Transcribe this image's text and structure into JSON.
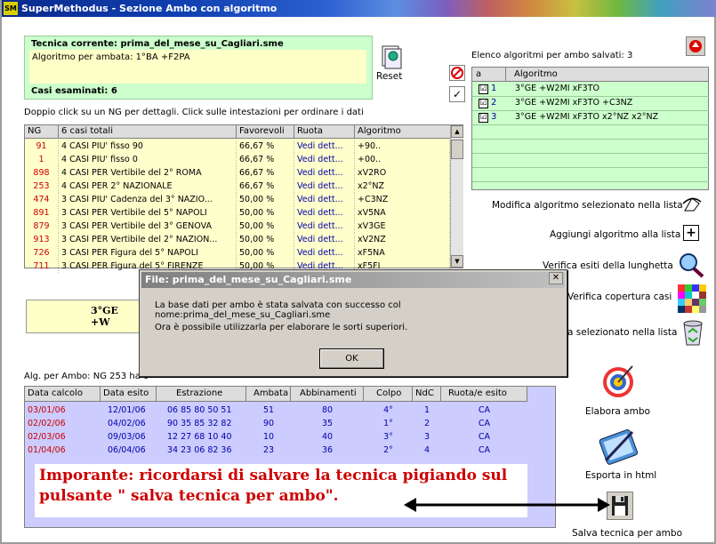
{
  "window": {
    "title": "SuperMethodus - Sezione Ambo con algoritmo",
    "icon_text": "SM"
  },
  "tecnica": {
    "title": "Tecnica corrente: prima_del_mese_su_Cagliari.sme",
    "algoritmo": "Algoritmo per ambata: 1°BA +F2PA",
    "casi": "Casi esaminati: 6"
  },
  "reset_label": "Reset",
  "hint_text": "Doppio click su un NG per dettagli. Click sulle intestazioni per ordinare i dati",
  "ng_table": {
    "headers": [
      "NG",
      "6 casi totali",
      "Favorevoli",
      "Ruota",
      "Algoritmo"
    ],
    "rows": [
      [
        "91",
        "4 CASI PIU' fisso 90",
        "66,67 %",
        "Vedi dett...",
        "+90.."
      ],
      [
        "1",
        "4 CASI PIU' fisso 0",
        "66,67 %",
        "Vedi dett...",
        "+00.."
      ],
      [
        "898",
        "4 CASI PER Vertibile del 2° ROMA",
        "66,67 %",
        "Vedi dett...",
        "xV2RO"
      ],
      [
        "253",
        "4 CASI PER 2° NAZIONALE",
        "66,67 %",
        "Vedi dett...",
        "x2°NZ"
      ],
      [
        "474",
        "3 CASI PIU' Cadenza del 3° NAZIO...",
        "50,00 %",
        "Vedi dett...",
        "+C3NZ"
      ],
      [
        "891",
        "3 CASI PER Vertibile del 5° NAPOLI",
        "50,00 %",
        "Vedi dett...",
        "xV5NA"
      ],
      [
        "879",
        "3 CASI PER Vertibile del 3° GENOVA",
        "50,00 %",
        "Vedi dett...",
        "xV3GE"
      ],
      [
        "913",
        "3 CASI PER Vertibile del 2° NAZION...",
        "50,00 %",
        "Vedi dett...",
        "xV2NZ"
      ],
      [
        "726",
        "3 CASI PER Figura del 5° NAPOLI",
        "50,00 %",
        "Vedi dett...",
        "xF5NA"
      ],
      [
        "711",
        "3 CASI PER Figura del 5° FIRENZE",
        "50,00 %",
        "Vedi dett...",
        "xF5FI"
      ]
    ]
  },
  "yellow_text": "3°GE +W",
  "elenco_label": "Elenco algoritmi per ambo salvati: 3",
  "algo_list": {
    "headers": [
      "a",
      "Algoritmo"
    ],
    "rows": [
      {
        "checked": "☑",
        "n": "1",
        "alg": "3°GE +W2MI xF3TO"
      },
      {
        "checked": "☑",
        "n": "2",
        "alg": "3°GE +W2MI xF3TO +C3NZ"
      },
      {
        "checked": "☑",
        "n": "3",
        "alg": "3°GE +W2MI xF3TO x2°NZ x2°NZ"
      }
    ]
  },
  "actions": {
    "modifica": "Modifica algoritmo selezionato nella lista",
    "aggiungi": "Aggiungi algoritmo alla lista",
    "verifica_esiti": "Verifica esiti della lunghetta",
    "verifica_copertura": "Verifica copertura casi",
    "elimina": "a selezionato nella lista",
    "elabora": "Elabora ambo",
    "esporta": "Esporta in html",
    "salva": "Salva tecnica per ambo"
  },
  "dialog": {
    "title": "File: prima_del_mese_su_Cagliari.sme",
    "line1": "La base dati per ambo è stata salvata con successo col nome:prima_del_mese_su_Cagliari.sme",
    "line2": "Ora è possibile utilizzarla per elaborare le sorti superiori.",
    "ok": "OK",
    "close": "✕"
  },
  "alg_label": "Alg. per Ambo: NG 253 ha c",
  "results": {
    "headers": [
      "Data calcolo",
      "Data esito",
      "Estrazione",
      "Ambata",
      "Abbinamenti",
      "Colpo",
      "NdC",
      "Ruota/e esito"
    ],
    "rows": [
      [
        "03/01/06",
        "12/01/06",
        "06 85 80 50 51",
        "51",
        "80",
        "4°",
        "1",
        "CA"
      ],
      [
        "02/02/06",
        "04/02/06",
        "90 35 85 32 82",
        "90",
        "35",
        "1°",
        "2",
        "CA"
      ],
      [
        "02/03/06",
        "09/03/06",
        "12 27 68 10 40",
        "10",
        "40",
        "3°",
        "3",
        "CA"
      ],
      [
        "01/04/06",
        "06/04/06",
        "34 23 06 82 36",
        "23",
        "36",
        "2°",
        "4",
        "CA"
      ]
    ]
  },
  "note_text": "Imporante: ricordarsi di salvare la tecnica pigiando sul pulsante \" salva tecnica per ambo\".",
  "colors": {
    "accent": "#0a2a8c",
    "grid_bg": "#ffffcc",
    "green": "#ccffcc",
    "lilac": "#ccccff",
    "red_text": "#cc0000"
  }
}
